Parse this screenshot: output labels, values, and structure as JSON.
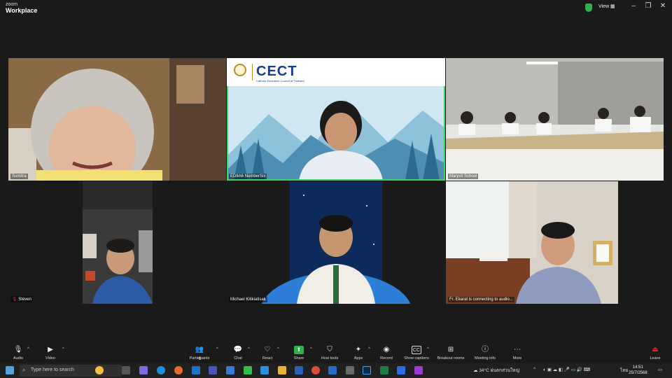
{
  "app": {
    "brand_small": "zoom",
    "brand_title": "Workplace",
    "view_label": "View"
  },
  "tiles": [
    {
      "label": "Sumitra"
    },
    {
      "label": "ED8A6 NumberSix",
      "banner": "CECT",
      "banner_sub": "Catholic Education Council of Thailand"
    },
    {
      "label": "Maryvit School"
    },
    {
      "label": "Steven"
    },
    {
      "label": "Michael Kitikiatisak"
    },
    {
      "label": "Fr. Ekarat is connecting to audio..."
    }
  ],
  "toolbar": {
    "audio": "Audio",
    "video": "Video",
    "participants": "Participants",
    "participants_count": "6",
    "chat": "Chat",
    "react": "React",
    "share": "Share",
    "host_tools": "Host tools",
    "apps": "Apps",
    "record": "Record",
    "show_captions": "Show captions",
    "breakout_rooms": "Breakout rooms",
    "meeting_info": "Meeting info",
    "more": "More",
    "leave": "Leave"
  },
  "taskbar": {
    "search_placeholder": "Type here to search",
    "weather": "34°C",
    "weather_text": "ฝนตกส่วนใหญ่",
    "lang": "ไทย",
    "time": "14:51",
    "date": "25/7/2568"
  },
  "colors": {
    "active_speaker": "#3ed26b",
    "share": "#2fb24c",
    "leave": "#e02828"
  }
}
